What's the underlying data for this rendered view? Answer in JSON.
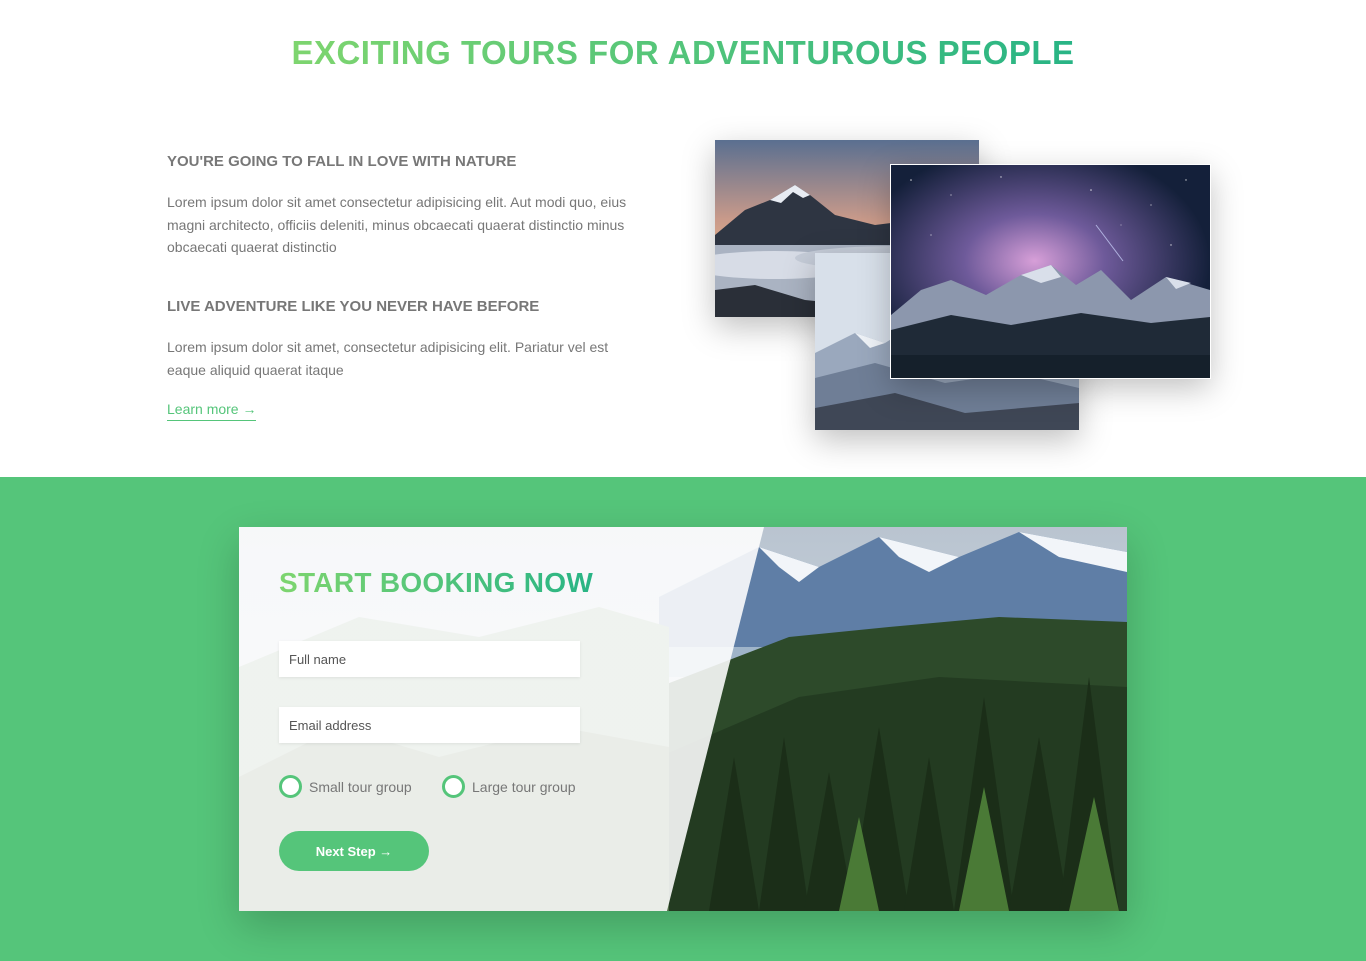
{
  "about": {
    "title": "EXCITING TOURS FOR ADVENTUROUS PEOPLE",
    "heading_1": "YOU'RE GOING TO FALL IN LOVE WITH NATURE",
    "text_1": "Lorem ipsum dolor sit amet consectetur adipisicing elit. Aut modi quo, eius magni architecto, officiis deleniti, minus obcaecati quaerat distinctio minus obcaecati quaerat distinctio",
    "heading_2": "LIVE ADVENTURE LIKE YOU NEVER HAVE BEFORE",
    "text_2": "Lorem ipsum dolor sit amet, consectetur adipisicing elit. Pariatur vel est eaque aliquid quaerat itaque",
    "learn_more": "Learn more →"
  },
  "booking": {
    "title": "START BOOKING NOW",
    "full_name_placeholder": "Full name",
    "email_placeholder": "Email address",
    "options": [
      "Small tour group",
      "Large tour group"
    ],
    "submit_label": "Next Step →"
  },
  "colors": {
    "accent": "#55c57a",
    "gradient_start": "#7ed56f",
    "gradient_end": "#28b485"
  }
}
